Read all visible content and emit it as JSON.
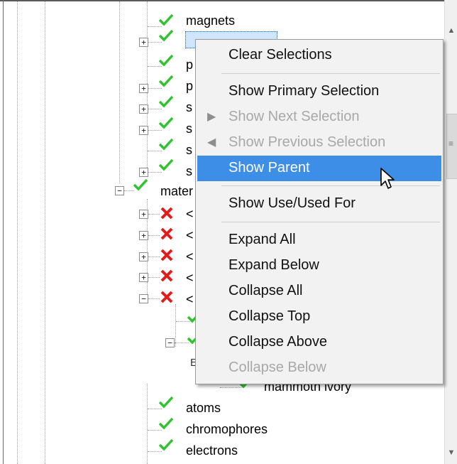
{
  "tree": {
    "visible_labels": {
      "magnets": "magnets",
      "row_p1": "p",
      "row_p2": "p",
      "row_s1": "s",
      "row_s2": "s",
      "row_s3": "s",
      "row_s4": "s",
      "materials": "mater",
      "x_row_1": "<",
      "x_row_2": "<",
      "x_row_3": "<",
      "x_row_4": "<",
      "x_row_5": "<",
      "row_e": "E",
      "mammoth": "mammoth ivory",
      "atoms": "atoms",
      "chromophores": "chromophores",
      "electrons": "electrons"
    },
    "expander_plus": "+",
    "expander_minus": "−"
  },
  "context_menu": {
    "items": [
      {
        "label": "Clear Selections",
        "enabled": true
      },
      {
        "label": "Show Primary Selection",
        "enabled": true
      },
      {
        "label": "Show Next Selection",
        "enabled": false
      },
      {
        "label": "Show Previous Selection",
        "enabled": false
      },
      {
        "label": "Show Parent",
        "enabled": true,
        "highlighted": true
      },
      {
        "label": "Show Use/Used For",
        "enabled": true
      },
      {
        "label": "Expand All",
        "enabled": true
      },
      {
        "label": "Expand Below",
        "enabled": true
      },
      {
        "label": "Collapse All",
        "enabled": true
      },
      {
        "label": "Collapse Top",
        "enabled": true
      },
      {
        "label": "Collapse Above",
        "enabled": true
      },
      {
        "label": "Collapse Below",
        "enabled": false
      }
    ],
    "next_arrow": "▶",
    "prev_arrow": "◀"
  },
  "scrollbar": {
    "up_arrow": "▲",
    "down_arrow": "▼",
    "grip": "≡"
  },
  "colors": {
    "check_green": "#2fc42f",
    "error_red": "#e21b1b",
    "menu_highlight": "#3d8ee6",
    "menu_background": "#f2f2f2",
    "disabled_text": "#a8a8a8",
    "selected_node_bg": "#cfe6fb"
  },
  "icons": {
    "check": "check-icon",
    "error": "x-icon",
    "cursor": "mouse-pointer-icon"
  }
}
